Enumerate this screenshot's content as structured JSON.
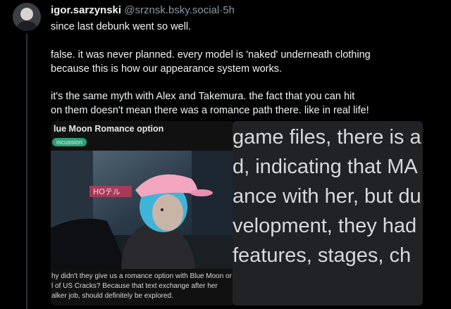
{
  "post": {
    "author_name": "igor.sarzynski",
    "handle": "@srznsk.bsky.social",
    "separator": "·",
    "time": "5h",
    "paragraphs": [
      "since last debunk went so well.",
      "false. it was never planned. every model is 'naked' underneath clothing\nbecause this is how our appearance system works.",
      "it's the same myth with Alex and Takemura. the fact that you can hit\non them doesn't mean there was a romance path there. like in real life!"
    ]
  },
  "embed_left": {
    "title": "lue Moon Romance option",
    "flair": "iscussion",
    "body_lines": [
      "hy didn't they give us a romance option with Blue Moon or",
      "l of US Cracks? Because that text exchange after her",
      "alker job, should definitely be explored."
    ],
    "image_icon": "game-screenshot-pink-cap-character"
  },
  "embed_right": {
    "lines": [
      "game files, there is a",
      "d, indicating that MA",
      "ance with her, but du",
      "velopment, they had",
      " features, stages, ch"
    ]
  },
  "colors": {
    "background": "#000000",
    "text": "#f1f3f5",
    "muted": "#8b98a5",
    "flair": "#2e9f7a",
    "card_right_bg": "#202225"
  }
}
